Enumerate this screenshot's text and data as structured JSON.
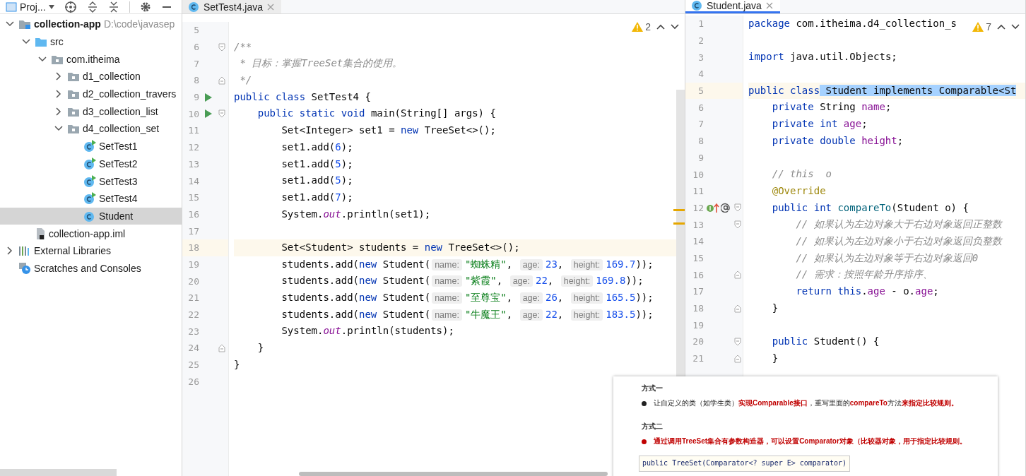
{
  "project_panel": {
    "title": "Proj...",
    "tree": [
      {
        "label": "collection-app",
        "kind": "module",
        "hint": "D:\\code\\javasep",
        "expanded": true,
        "selected": false,
        "children": [
          {
            "label": "src",
            "kind": "source",
            "expanded": true,
            "selected": false,
            "children": [
              {
                "label": "com.itheima",
                "kind": "package",
                "expanded": true,
                "selected": false,
                "children": [
                  {
                    "label": "d1_collection",
                    "kind": "package",
                    "expanded": false,
                    "selected": false
                  },
                  {
                    "label": "d2_collection_travers",
                    "kind": "package",
                    "expanded": false,
                    "selected": false
                  },
                  {
                    "label": "d3_collection_list",
                    "kind": "package",
                    "expanded": false,
                    "selected": false
                  },
                  {
                    "label": "d4_collection_set",
                    "kind": "package",
                    "expanded": true,
                    "selected": false,
                    "children": [
                      {
                        "label": "SetTest1",
                        "kind": "runnable-class",
                        "selected": false
                      },
                      {
                        "label": "SetTest2",
                        "kind": "runnable-class",
                        "selected": false
                      },
                      {
                        "label": "SetTest3",
                        "kind": "runnable-class",
                        "selected": false
                      },
                      {
                        "label": "SetTest4",
                        "kind": "runnable-class",
                        "selected": false
                      },
                      {
                        "label": "Student",
                        "kind": "class",
                        "selected": true
                      }
                    ]
                  }
                ]
              }
            ]
          },
          {
            "label": "collection-app.iml",
            "kind": "iml",
            "selected": false
          }
        ]
      },
      {
        "label": "External Libraries",
        "kind": "libraries",
        "expanded": false,
        "selected": false
      },
      {
        "label": "Scratches and Consoles",
        "kind": "scratches",
        "selected": false
      }
    ]
  },
  "editors": [
    {
      "tabs": [
        {
          "label": "SetTest4.java",
          "selected": false
        }
      ],
      "warnings": "2",
      "lines": [
        {
          "number": "5",
          "current": false
        },
        {
          "number": "6",
          "current": false,
          "gutter": [
            {
              "kind": "fold-start"
            }
          ],
          "tokens": [
            {
              "kind": "doc",
              "v": "/**"
            }
          ]
        },
        {
          "number": "7",
          "current": false,
          "tokens": [
            {
              "kind": "doc",
              "v": " * 目标：掌握TreeSet集合的使用。"
            }
          ]
        },
        {
          "number": "8",
          "current": false,
          "gutter": [
            {
              "kind": "fold-end"
            }
          ],
          "tokens": [
            {
              "kind": "doc",
              "v": " */"
            }
          ]
        },
        {
          "number": "9",
          "current": false,
          "gutter": [
            {
              "kind": "run"
            }
          ],
          "tokens": [
            {
              "kind": "keyword",
              "v": "public class "
            },
            {
              "kind": "plain",
              "v": "SetTest4 {"
            }
          ]
        },
        {
          "number": "10",
          "current": false,
          "gutter": [
            {
              "kind": "run"
            },
            {
              "kind": "fold-start"
            }
          ],
          "tokens": [
            {
              "kind": "keyword",
              "v": "    public static void "
            },
            {
              "kind": "plain",
              "v": "main(String[] args) {"
            }
          ]
        },
        {
          "number": "11",
          "current": false,
          "tokens": [
            {
              "kind": "plain",
              "v": "        Set<Integer> set1 = "
            },
            {
              "kind": "keyword",
              "v": "new "
            },
            {
              "kind": "plain",
              "v": "TreeSet<>();"
            }
          ]
        },
        {
          "number": "12",
          "current": false,
          "tokens": [
            {
              "kind": "plain",
              "v": "        set1.add("
            },
            {
              "kind": "number",
              "v": "6"
            },
            {
              "kind": "plain",
              "v": ");"
            }
          ]
        },
        {
          "number": "13",
          "current": false,
          "tokens": [
            {
              "kind": "plain",
              "v": "        set1.add("
            },
            {
              "kind": "number",
              "v": "5"
            },
            {
              "kind": "plain",
              "v": ");"
            }
          ]
        },
        {
          "number": "14",
          "current": false,
          "tokens": [
            {
              "kind": "plain",
              "v": "        set1.add("
            },
            {
              "kind": "number",
              "v": "5"
            },
            {
              "kind": "plain",
              "v": ");"
            }
          ]
        },
        {
          "number": "15",
          "current": false,
          "tokens": [
            {
              "kind": "plain",
              "v": "        set1.add("
            },
            {
              "kind": "number",
              "v": "7"
            },
            {
              "kind": "plain",
              "v": ");"
            }
          ]
        },
        {
          "number": "16",
          "current": false,
          "tokens": [
            {
              "kind": "plain",
              "v": "        System."
            },
            {
              "kind": "static",
              "v": "out"
            },
            {
              "kind": "plain",
              "v": ".println(set1);"
            }
          ]
        },
        {
          "number": "17",
          "current": false
        },
        {
          "number": "18",
          "current": true,
          "tokens": [
            {
              "kind": "plain",
              "v": "        Set<Student> students = "
            },
            {
              "kind": "keyword",
              "v": "new "
            },
            {
              "kind": "plain",
              "v": "TreeSet<>();"
            }
          ]
        },
        {
          "number": "19",
          "current": false,
          "tokens": [
            {
              "kind": "plain",
              "v": "        students.add("
            },
            {
              "kind": "keyword",
              "v": "new "
            },
            {
              "kind": "plain",
              "v": "Student("
            },
            {
              "kind": "hint",
              "v": "name:"
            },
            {
              "kind": "string",
              "v": "\"蜘蛛精\""
            },
            {
              "kind": "plain",
              "v": ", "
            },
            {
              "kind": "hint",
              "v": "age:"
            },
            {
              "kind": "number",
              "v": "23"
            },
            {
              "kind": "plain",
              "v": ", "
            },
            {
              "kind": "hint",
              "v": "height:"
            },
            {
              "kind": "number",
              "v": "169.7"
            },
            {
              "kind": "plain",
              "v": "));"
            }
          ]
        },
        {
          "number": "20",
          "current": false,
          "tokens": [
            {
              "kind": "plain",
              "v": "        students.add("
            },
            {
              "kind": "keyword",
              "v": "new "
            },
            {
              "kind": "plain",
              "v": "Student("
            },
            {
              "kind": "hint",
              "v": "name:"
            },
            {
              "kind": "string",
              "v": "\"紫霞\""
            },
            {
              "kind": "plain",
              "v": ", "
            },
            {
              "kind": "hint",
              "v": "age:"
            },
            {
              "kind": "number",
              "v": "22"
            },
            {
              "kind": "plain",
              "v": ", "
            },
            {
              "kind": "hint",
              "v": "height:"
            },
            {
              "kind": "number",
              "v": "169.8"
            },
            {
              "kind": "plain",
              "v": "));"
            }
          ]
        },
        {
          "number": "21",
          "current": false,
          "tokens": [
            {
              "kind": "plain",
              "v": "        students.add("
            },
            {
              "kind": "keyword",
              "v": "new "
            },
            {
              "kind": "plain",
              "v": "Student("
            },
            {
              "kind": "hint",
              "v": "name:"
            },
            {
              "kind": "string",
              "v": "\"至尊宝\""
            },
            {
              "kind": "plain",
              "v": ", "
            },
            {
              "kind": "hint",
              "v": "age:"
            },
            {
              "kind": "number",
              "v": "26"
            },
            {
              "kind": "plain",
              "v": ", "
            },
            {
              "kind": "hint",
              "v": "height:"
            },
            {
              "kind": "number",
              "v": "165.5"
            },
            {
              "kind": "plain",
              "v": "));"
            }
          ]
        },
        {
          "number": "22",
          "current": false,
          "tokens": [
            {
              "kind": "plain",
              "v": "        students.add("
            },
            {
              "kind": "keyword",
              "v": "new "
            },
            {
              "kind": "plain",
              "v": "Student("
            },
            {
              "kind": "hint",
              "v": "name:"
            },
            {
              "kind": "string",
              "v": "\"牛魔王\""
            },
            {
              "kind": "plain",
              "v": ", "
            },
            {
              "kind": "hint",
              "v": "age:"
            },
            {
              "kind": "number",
              "v": "22"
            },
            {
              "kind": "plain",
              "v": ", "
            },
            {
              "kind": "hint",
              "v": "height:"
            },
            {
              "kind": "number",
              "v": "183.5"
            },
            {
              "kind": "plain",
              "v": "));"
            }
          ]
        },
        {
          "number": "23",
          "current": false,
          "tokens": [
            {
              "kind": "plain",
              "v": "        System."
            },
            {
              "kind": "static",
              "v": "out"
            },
            {
              "kind": "plain",
              "v": ".println(students);"
            }
          ]
        },
        {
          "number": "24",
          "current": false,
          "gutter": [
            {
              "kind": "fold-end"
            }
          ],
          "tokens": [
            {
              "kind": "plain",
              "v": "    }"
            }
          ]
        },
        {
          "number": "25",
          "current": false,
          "tokens": [
            {
              "kind": "plain",
              "v": "}"
            }
          ]
        },
        {
          "number": "26",
          "current": false
        }
      ]
    },
    {
      "tabs": [
        {
          "label": "Student.java",
          "selected": true
        }
      ],
      "warnings": "7",
      "lines": [
        {
          "number": "1",
          "current": false,
          "tokens": [
            {
              "kind": "keyword",
              "v": "package "
            },
            {
              "kind": "plain",
              "v": "com.itheima.d4_collection_s"
            }
          ]
        },
        {
          "number": "2",
          "current": false
        },
        {
          "number": "3",
          "current": false,
          "tokens": [
            {
              "kind": "keyword",
              "v": "import "
            },
            {
              "kind": "plain",
              "v": "java.util.Objects;"
            }
          ]
        },
        {
          "number": "4",
          "current": false
        },
        {
          "number": "5",
          "current": true,
          "tokens": [
            {
              "kind": "keyword",
              "v": "public class"
            },
            {
              "kind": "selection",
              "v": " Student implements Comparable<St"
            }
          ]
        },
        {
          "number": "6",
          "current": false,
          "tokens": [
            {
              "kind": "keyword",
              "v": "    private "
            },
            {
              "kind": "plain",
              "v": "String "
            },
            {
              "kind": "field",
              "v": "name"
            },
            {
              "kind": "plain",
              "v": ";"
            }
          ]
        },
        {
          "number": "7",
          "current": false,
          "tokens": [
            {
              "kind": "keyword",
              "v": "    private int "
            },
            {
              "kind": "field",
              "v": "age"
            },
            {
              "kind": "plain",
              "v": ";"
            }
          ]
        },
        {
          "number": "8",
          "current": false,
          "tokens": [
            {
              "kind": "keyword",
              "v": "    private double "
            },
            {
              "kind": "field",
              "v": "height"
            },
            {
              "kind": "plain",
              "v": ";"
            }
          ]
        },
        {
          "number": "9",
          "current": false
        },
        {
          "number": "10",
          "current": false,
          "tokens": [
            {
              "kind": "comment",
              "v": "    // this  o"
            }
          ]
        },
        {
          "number": "11",
          "current": false,
          "tokens": [
            {
              "kind": "annotation",
              "v": "    @Override"
            }
          ]
        },
        {
          "number": "12",
          "current": false,
          "gutter": [
            {
              "kind": "override"
            },
            {
              "kind": "fold-start"
            }
          ],
          "tokens": [
            {
              "kind": "keyword",
              "v": "    public int "
            },
            {
              "kind": "method",
              "v": "compareTo"
            },
            {
              "kind": "plain",
              "v": "(Student o) {"
            }
          ]
        },
        {
          "number": "13",
          "current": false,
          "gutter": [
            {
              "kind": "fold-start"
            }
          ],
          "tokens": [
            {
              "kind": "comment",
              "v": "        // 如果认为左边对象大于右边对象返回正整数"
            }
          ]
        },
        {
          "number": "14",
          "current": false,
          "tokens": [
            {
              "kind": "comment",
              "v": "        // 如果认为左边对象小于右边对象返回负整数"
            }
          ]
        },
        {
          "number": "15",
          "current": false,
          "tokens": [
            {
              "kind": "comment",
              "v": "        // 如果认为左边对象等于右边对象返回0"
            }
          ]
        },
        {
          "number": "16",
          "current": false,
          "gutter": [
            {
              "kind": "fold-end"
            }
          ],
          "tokens": [
            {
              "kind": "comment",
              "v": "        // 需求：按照年龄升序排序、"
            }
          ]
        },
        {
          "number": "17",
          "current": false,
          "tokens": [
            {
              "kind": "keyword",
              "v": "        return this"
            },
            {
              "kind": "plain",
              "v": "."
            },
            {
              "kind": "field",
              "v": "age"
            },
            {
              "kind": "plain",
              "v": " - o."
            },
            {
              "kind": "field",
              "v": "age"
            },
            {
              "kind": "plain",
              "v": ";"
            }
          ]
        },
        {
          "number": "18",
          "current": false,
          "gutter": [
            {
              "kind": "fold-end"
            }
          ],
          "tokens": [
            {
              "kind": "plain",
              "v": "    }"
            }
          ]
        },
        {
          "number": "19",
          "current": false
        },
        {
          "number": "20",
          "current": false,
          "gutter": [
            {
              "kind": "fold-start"
            }
          ],
          "tokens": [
            {
              "kind": "keyword",
              "v": "    public "
            },
            {
              "kind": "plain",
              "v": "Student() {"
            }
          ]
        },
        {
          "number": "21",
          "current": false,
          "gutter": [
            {
              "kind": "fold-end"
            }
          ],
          "tokens": [
            {
              "kind": "plain",
              "v": "    }"
            }
          ]
        }
      ]
    }
  ],
  "notes": {
    "sections": [
      {
        "heading": "方式一",
        "bullet": {
          "emphasis": false,
          "text": "让自定义的类（如学生类）**实现Comparable接口**，重写里面的**compareTo**方法**来指定比较规则。**"
        }
      },
      {
        "heading": "方式二",
        "bullet": {
          "emphasis": true,
          "text": "通过调用TreeSet集合有参数构造器，可以设置Comparator对象（比较器对象，用于指定比较规则。"
        }
      }
    ],
    "signature": "public TreeSet(Comparator<? super E> comparator)"
  }
}
